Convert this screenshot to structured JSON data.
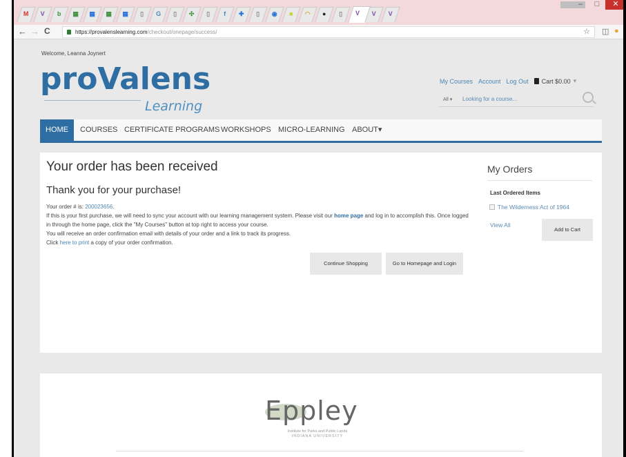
{
  "browser": {
    "tabs": [
      {
        "letter": "M",
        "color": "#d93025"
      },
      {
        "letter": "V",
        "color": "#7b4ea3"
      },
      {
        "letter": "b",
        "color": "#3e8f3e"
      },
      {
        "letter": "▦",
        "color": "#3e8f3e"
      },
      {
        "letter": "▦",
        "color": "#2a73d8"
      },
      {
        "letter": "▦",
        "color": "#3e8f3e"
      },
      {
        "letter": "▦",
        "color": "#2a73d8"
      },
      {
        "letter": "▯",
        "color": "#888888"
      },
      {
        "letter": "G",
        "color": "#4a86b5"
      },
      {
        "letter": "▯",
        "color": "#888888"
      },
      {
        "letter": "✣",
        "color": "#3e8f3e"
      },
      {
        "letter": "▯",
        "color": "#888888"
      },
      {
        "letter": "f",
        "color": "#4a86b5"
      },
      {
        "letter": "✚",
        "color": "#2a73d8"
      },
      {
        "letter": "▯",
        "color": "#888888"
      },
      {
        "letter": "◉",
        "color": "#2a73d8"
      },
      {
        "letter": "■",
        "color": "#c8d23a"
      },
      {
        "letter": "◠",
        "color": "#e6a534"
      },
      {
        "letter": "●",
        "color": "#222222"
      },
      {
        "letter": "▯",
        "color": "#888888"
      },
      {
        "letter": "V",
        "color": "#7b4ea3"
      },
      {
        "letter": "V",
        "color": "#7b4ea3"
      },
      {
        "letter": "V",
        "color": "#7b4ea3"
      }
    ],
    "active_tab_close": "×",
    "url_host": "https://provalenslearning.com",
    "url_path": "/checkout/onepage/success/",
    "back": "←",
    "forward": "→",
    "reload": "C",
    "star": "☆"
  },
  "header": {
    "welcome": "Welcome, Leanna Joynert",
    "logo_main": "proValens",
    "logo_sub": "Learning",
    "links": {
      "my_courses": "My Courses",
      "account": "Account",
      "logout": "Log Out",
      "cart": "Cart $0.00"
    },
    "search": {
      "scope": "All ▾",
      "placeholder": "Looking for a course..."
    }
  },
  "nav": {
    "items": [
      "HOME",
      "COURSES",
      "CERTIFICATE PROGRAMS",
      "WORKSHOPS",
      "MICRO-LEARNING",
      "ABOUT▾"
    ]
  },
  "order": {
    "title": "Your order has been received",
    "subtitle": "Thank you for your purchase!",
    "order_prefix": "Your order # is: ",
    "order_number": "200023656",
    "line1_a": "If this is your first purchase, we will need to sync your account with our learning management system. Please visit our ",
    "line1_link": "home page",
    "line1_b": " and log in to accomplish this. Once logged in through the home page, click the \"My Courses\" button at top right to access your course.",
    "line2": "You will receive an order confirmation email with details of your order and a link to track its progress.",
    "line3_a": "Click ",
    "line3_link": "here to print",
    "line3_b": " a copy of your order confirmation.",
    "continue_button": "Continue Shopping",
    "home_button": "Go to Homepage and Login"
  },
  "sidebar": {
    "title": "My Orders",
    "last_ordered": "Last Ordered Items",
    "item": "The Wilderness Act of 1964",
    "view_all": "View All",
    "add_to_cart": "Add to Cart"
  },
  "footer": {
    "logo": "Eppley",
    "logo_sub_1": "Institute for Parks and Public Lands",
    "logo_sub_2": "INDIANA UNIVERSITY"
  }
}
